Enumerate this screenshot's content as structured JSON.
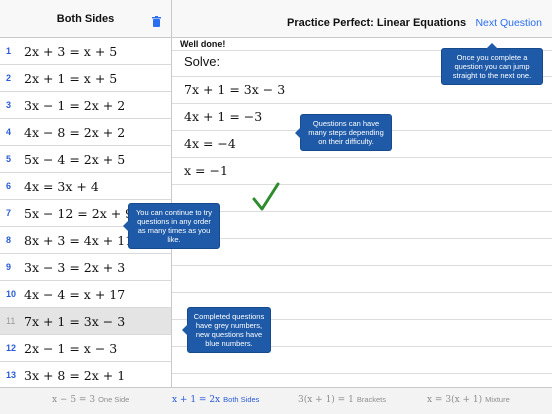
{
  "sidebar": {
    "title": "Both Sides",
    "questions": [
      {
        "num": "1",
        "eq": "2x + 3 = x + 5",
        "done": false
      },
      {
        "num": "2",
        "eq": "2x + 1 = x + 5",
        "done": false
      },
      {
        "num": "3",
        "eq": "3x − 1 = 2x + 2",
        "done": false
      },
      {
        "num": "4",
        "eq": "4x − 8 = 2x + 2",
        "done": false
      },
      {
        "num": "5",
        "eq": "5x − 4 = 2x + 5",
        "done": false
      },
      {
        "num": "6",
        "eq": "4x = 3x + 4",
        "done": false
      },
      {
        "num": "7",
        "eq": "5x − 12 = 2x + 9",
        "done": false
      },
      {
        "num": "8",
        "eq": "8x + 3 = 4x + 11",
        "done": false
      },
      {
        "num": "9",
        "eq": "3x − 3 = 2x + 3",
        "done": false
      },
      {
        "num": "10",
        "eq": "4x − 4 = x + 17",
        "done": false
      },
      {
        "num": "11",
        "eq": "7x + 1 = 3x − 3",
        "done": true
      },
      {
        "num": "12",
        "eq": "2x − 1 = x − 3",
        "done": false
      },
      {
        "num": "13",
        "eq": "3x + 8 = 2x + 1",
        "done": false
      }
    ]
  },
  "header": {
    "title": "Practice Perfect: Linear Equations",
    "next_label": "Next Question"
  },
  "workspace": {
    "feedback": "Well done!",
    "solve_label": "Solve:",
    "steps": [
      "7x + 1 = 3x − 3",
      "4x + 1 = −3",
      "4x = −4",
      "x = −1"
    ]
  },
  "tooltips": {
    "next": "Once you complete a question you can jump straight to the next one.",
    "steps": "Questions can have many steps depending on their difficulty.",
    "order": "You can continue to try questions in any order as many times as you like.",
    "colors": "Completed questions have grey numbers, new questions have blue numbers."
  },
  "tabs": [
    {
      "math": "x − 5 = 3",
      "label": "One Side",
      "active": false
    },
    {
      "math": "x + 1 = 2x",
      "label": "Both Sides",
      "active": true
    },
    {
      "math": "3(x + 1) = 1",
      "label": "Brackets",
      "active": false
    },
    {
      "math": "x = 3(x + 1)",
      "label": "Mixture",
      "active": false
    }
  ],
  "colors": {
    "accent": "#2a5bd7",
    "tooltip": "#1e5aa8",
    "check": "#2e8b2e"
  }
}
